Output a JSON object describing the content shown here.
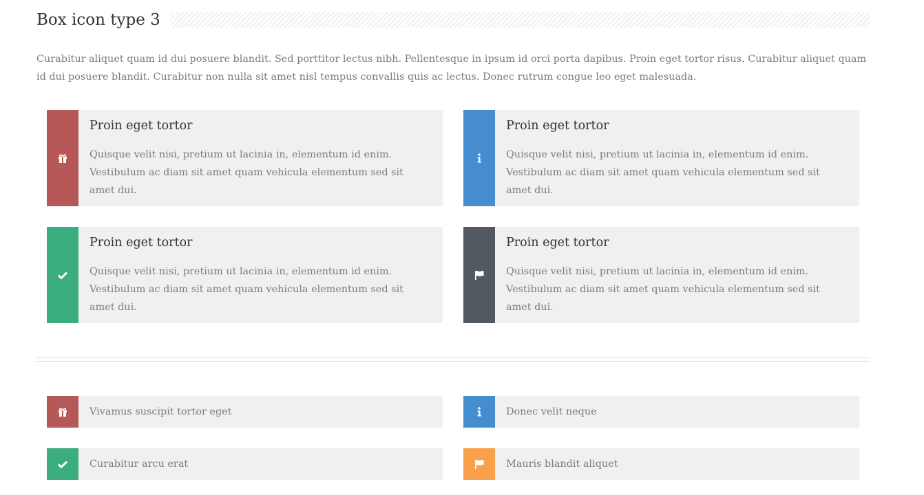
{
  "section": {
    "title": "Box icon type 3",
    "intro": "Curabitur aliquet quam id dui posuere blandit. Sed porttitor lectus nibh. Pellentesque in ipsum id orci porta dapibus. Proin eget tortor risus. Curabitur aliquet quam id dui posuere blandit. Curabitur non nulla sit amet nisl tempus convallis quis ac lectus. Donec rutrum congue leo eget malesuada."
  },
  "boxes": [
    {
      "title": "Proin eget tortor",
      "text": "Quisque velit nisi, pretium ut lacinia in, elementum id enim. Vestibulum ac diam sit amet quam vehicula elementum sed sit amet dui.",
      "icon": "gift-icon",
      "color": "#b65858"
    },
    {
      "title": "Proin eget tortor",
      "text": "Quisque velit nisi, pretium ut lacinia in, elementum id enim. Vestibulum ac diam sit amet quam vehicula elementum sed sit amet dui.",
      "icon": "info-icon",
      "color": "#468dd0"
    },
    {
      "title": "Proin eget tortor",
      "text": "Quisque velit nisi, pretium ut lacinia in, elementum id enim. Vestibulum ac diam sit amet quam vehicula elementum sed sit amet dui.",
      "icon": "check-icon",
      "color": "#3bad7e"
    },
    {
      "title": "Proin eget tortor",
      "text": "Quisque velit nisi, pretium ut lacinia in, elementum id enim. Vestibulum ac diam sit amet quam vehicula elementum sed sit amet dui.",
      "icon": "flag-icon",
      "color": "#535960"
    }
  ],
  "small_boxes": [
    {
      "label": "Vivamus suscipit tortor eget",
      "icon": "gift-icon",
      "color": "#b65858"
    },
    {
      "label": "Donec velit neque",
      "icon": "info-icon",
      "color": "#468dd0"
    },
    {
      "label": "Curabitur arcu erat",
      "icon": "check-icon",
      "color": "#3bad7e"
    },
    {
      "label": "Mauris blandit aliquet",
      "icon": "flag-icon",
      "color": "#f8a04c"
    }
  ]
}
